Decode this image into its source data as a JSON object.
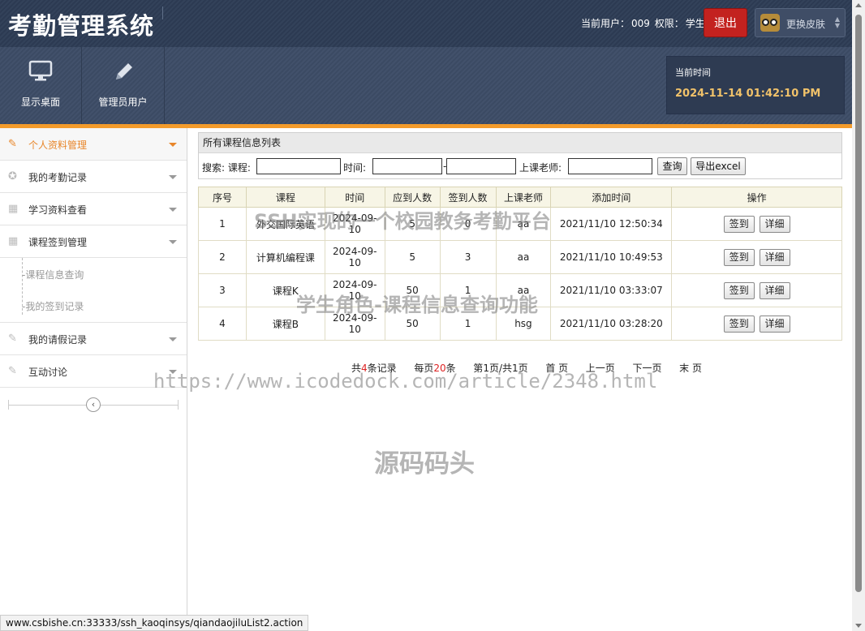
{
  "header": {
    "app_title": "考勤管理系统",
    "user_label": "当前用户：",
    "user_id": "009",
    "role_label": "权限：",
    "role": "学生",
    "logout_label": "退出",
    "skin_label": "更换皮肤"
  },
  "toolbar": {
    "desktop_label": "显示桌面",
    "admin_label": "管理员用户",
    "time_label": "当前时间",
    "time_value": "2024-11-14 01:42:10 PM"
  },
  "sidebar": {
    "items": [
      {
        "label": "个人资料管理",
        "icon": "pencil-icon"
      },
      {
        "label": "我的考勤记录",
        "icon": "lifebuoy-icon"
      },
      {
        "label": "学习资料查看",
        "icon": "grid-icon"
      },
      {
        "label": "课程签到管理",
        "icon": "grid-icon"
      },
      {
        "label": "我的请假记录",
        "icon": "pencil-icon"
      },
      {
        "label": "互动讨论",
        "icon": "pencil-icon"
      }
    ],
    "subitems": [
      "-课程信息查询",
      "-我的签到记录"
    ]
  },
  "panel": {
    "title": "所有课程信息列表",
    "search_label": "搜索: 课程:",
    "time_label": "时间:",
    "dash": "-",
    "teacher_label": "上课老师:",
    "query_button": "查询",
    "export_button": "导出excel"
  },
  "table": {
    "headers": [
      "序号",
      "课程",
      "时间",
      "应到人数",
      "签到人数",
      "上课老师",
      "添加时间",
      "操作"
    ],
    "rows": [
      {
        "no": "1",
        "course": "外交国际英语",
        "time": "2024-09-10",
        "expected": "5",
        "signed": "0",
        "teacher": "aa",
        "added": "2021/11/10 12:50:34"
      },
      {
        "no": "2",
        "course": "计算机编程课",
        "time": "2024-09-10",
        "expected": "5",
        "signed": "3",
        "teacher": "aa",
        "added": "2021/11/10 10:49:53"
      },
      {
        "no": "3",
        "course": "课程K",
        "time": "2024-09-10",
        "expected": "50",
        "signed": "1",
        "teacher": "aa",
        "added": "2021/11/10 03:33:07"
      },
      {
        "no": "4",
        "course": "课程B",
        "time": "2024-09-10",
        "expected": "50",
        "signed": "1",
        "teacher": "hsg",
        "added": "2021/11/10 03:28:20"
      }
    ],
    "signin_button": "签到",
    "detail_button": "详细"
  },
  "pager": {
    "total_prefix": "共",
    "total": "4",
    "total_suffix": "条记录",
    "per_prefix": "每页",
    "per": "20",
    "per_suffix": "条",
    "page_prefix": "第",
    "page": "1",
    "page_mid": "页/共",
    "pages": "1",
    "page_suffix": "页",
    "first": "首 页",
    "prev": "上一页",
    "next": "下一页",
    "last": "末 页"
  },
  "watermarks": {
    "line1": "SSH实现的一个校园教务考勤平台",
    "line2": "学生角色-课程信息查询功能",
    "url": "https://www.icodedock.com/article/2348.html",
    "brand": "源码码头"
  },
  "statusbar": {
    "url": "www.csbishe.cn:33333/ssh_kaoqinsys/qiandaojiluList2.action"
  },
  "colors": {
    "accent_orange": "#f39b2b",
    "logout_red": "#c3221f",
    "header_bg": "#33425a",
    "time_gold": "#f1c26a"
  }
}
